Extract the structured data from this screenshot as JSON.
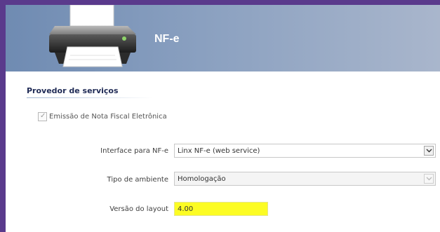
{
  "header": {
    "title": "NF-e",
    "icon": "printer-icon"
  },
  "section": {
    "title": "Provedor de serviços"
  },
  "nfe_checkbox": {
    "label": "Emissão de Nota Fiscal Eletrônica",
    "checked": true
  },
  "interface": {
    "label": "Interface para NF-e",
    "value": "Linx NF-e (web service)"
  },
  "ambiente": {
    "label": "Tipo de ambiente",
    "value": "Homologação"
  },
  "layout": {
    "label": "Versão do layout",
    "value": "4.00"
  },
  "colors": {
    "frame": "#5a3a8c",
    "header_start": "#6f8bb2",
    "header_end": "#a9b6cc",
    "highlight": "#fcfc24"
  }
}
